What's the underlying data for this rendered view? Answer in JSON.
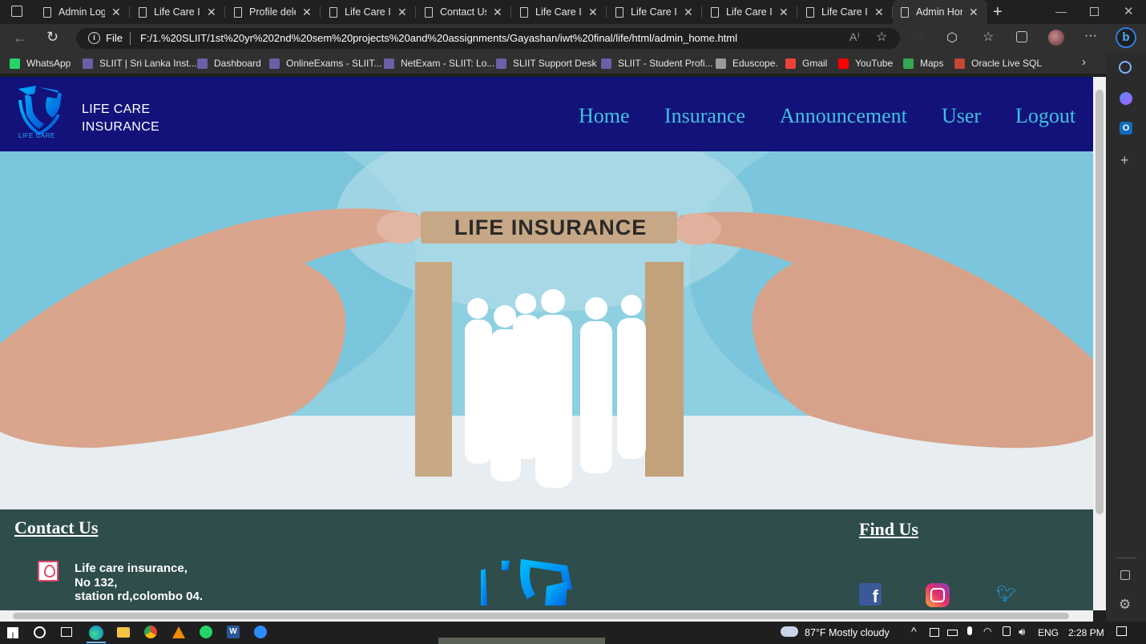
{
  "browser": {
    "tabs": [
      {
        "label": "Admin Logi"
      },
      {
        "label": "Life Care In"
      },
      {
        "label": "Profile dele"
      },
      {
        "label": "Life Care In"
      },
      {
        "label": "Contact Us"
      },
      {
        "label": "Life Care In"
      },
      {
        "label": "Life Care In"
      },
      {
        "label": "Life Care In"
      },
      {
        "label": "Life Care In"
      },
      {
        "label": "Admin Hon"
      }
    ],
    "url_scheme": "File",
    "url": "F:/1.%20SLIIT/1st%20yr%202nd%20sem%20projects%20and%20assignments/Gayashan/iwt%20final/life/html/admin_home.html",
    "bookmarks": [
      {
        "label": "WhatsApp",
        "color": "#25d366"
      },
      {
        "label": "SLIIT | Sri Lanka Inst...",
        "color": "#6b5fa7"
      },
      {
        "label": "Dashboard",
        "color": "#6b5fa7"
      },
      {
        "label": "OnlineExams - SLIIT...",
        "color": "#6b5fa7"
      },
      {
        "label": "NetExam - SLIIT: Lo...",
        "color": "#6b5fa7"
      },
      {
        "label": "SLIIT Support Desk",
        "color": "#6b5fa7"
      },
      {
        "label": "SLIIT - Student Profi...",
        "color": "#6b5fa7"
      },
      {
        "label": "Eduscope.",
        "color": "#9a9a9a"
      },
      {
        "label": "Gmail",
        "color": "#ea4335"
      },
      {
        "label": "YouTube",
        "color": "#ff0000"
      },
      {
        "label": "Maps",
        "color": "#34a853"
      },
      {
        "label": "Oracle Live SQL",
        "color": "#c74634"
      }
    ]
  },
  "site": {
    "brand_line1": "LIFE CARE",
    "brand_line2": "INSURANCE",
    "logo_caption": "LIFE CARE",
    "nav": [
      "Home",
      "Insurance",
      "Announcement",
      "User",
      "Logout"
    ],
    "hero_sign": "LIFE INSURANCE",
    "footer": {
      "contact_title": "Contact Us",
      "address_line1": "Life care insurance,",
      "address_line2": "No 132,",
      "address_line3": "station rd,colombo 04.",
      "find_us_title": "Find Us"
    }
  },
  "taskbar": {
    "weather": "87°F  Mostly cloudy",
    "language": "ENG",
    "time": "2:28 PM"
  }
}
